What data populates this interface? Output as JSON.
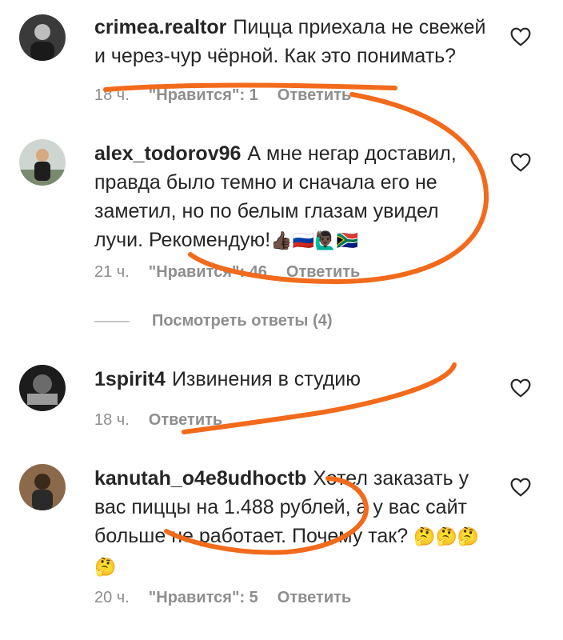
{
  "comments": [
    {
      "username": "crimea.realtor",
      "text": "Пицца приехала не свежей и через-чур чёрной. Как это понимать?",
      "time": "18 ч.",
      "likes": "\"Нравится\": 1",
      "reply": "Ответить"
    },
    {
      "username": "alex_todorov96",
      "text": "А мне негар доставил, правда было темно и сначала его не заметил, но по белым глазам увидел лучи. Рекомендую!",
      "emojis": "👍🏿🇷🇺🙋🏿‍♂️🇿🇦",
      "time": "21 ч.",
      "likes": "\"Нравится\": 46",
      "reply": "Ответить",
      "view_replies": "Посмотреть ответы (4)"
    },
    {
      "username": "1spirit4",
      "text": "Извинения в студию",
      "time": "18 ч.",
      "reply": "Ответить"
    },
    {
      "username": "kanutah_o4e8udhoctb",
      "text": "Хотел заказать у вас пиццы на 1.488 рублей, а у вас сайт больше не работает. Почему так?",
      "emojis": "🤔🤔🤔🤔",
      "time": "20 ч.",
      "likes": "\"Нравится\": 5",
      "reply": "Ответить"
    }
  ],
  "colors": {
    "text": "#262626",
    "meta": "#8e8e8e",
    "scribble": "#f26a1b"
  },
  "icons": [
    "avatar",
    "heart-outline-icon"
  ]
}
